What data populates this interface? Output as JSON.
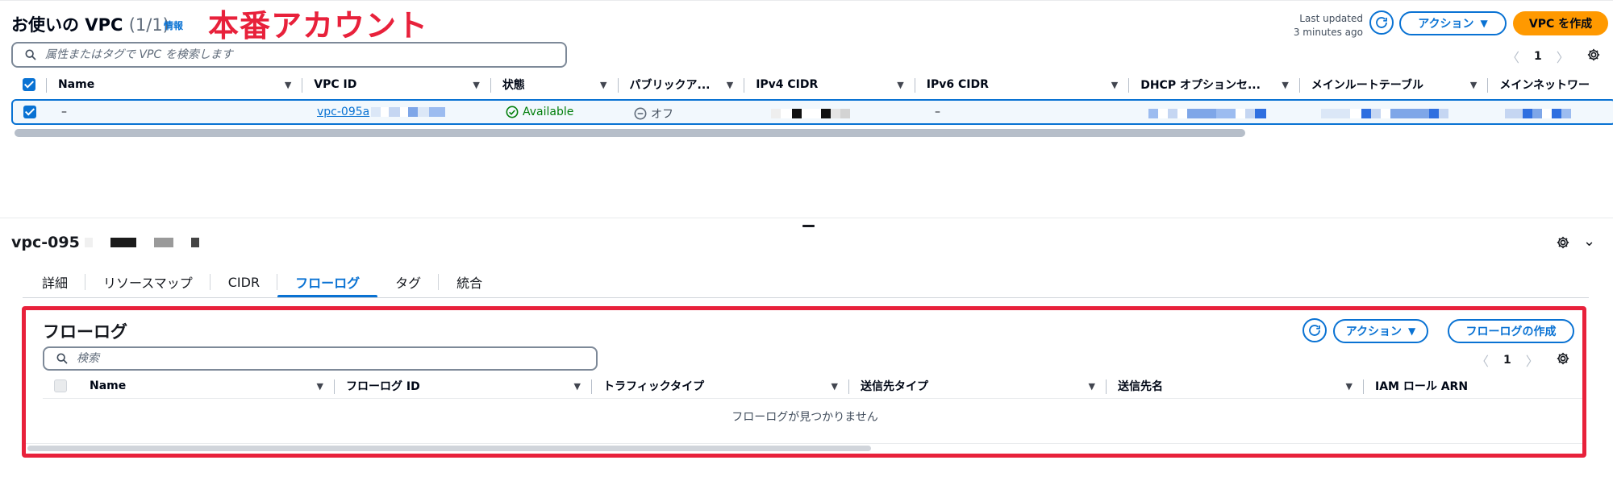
{
  "header": {
    "title": "お使いの VPC",
    "count": "(1/1)",
    "info": "情報",
    "prod_label": "本番アカウント",
    "last_updated_line1": "Last updated",
    "last_updated_line2": "3 minutes ago",
    "actions_label": "アクション",
    "create_vpc_label": "VPC を作成"
  },
  "search": {
    "placeholder": "属性またはタグで VPC を検索します"
  },
  "pagination": {
    "page": "1"
  },
  "table": {
    "columns": [
      "Name",
      "VPC ID",
      "状態",
      "パブリックア...",
      "IPv4 CIDR",
      "IPv6 CIDR",
      "DHCP オプションセ...",
      "メインルートテーブル",
      "メインネットワー"
    ],
    "row": {
      "name": "–",
      "vpc_id": "vpc-095a",
      "state": "Available",
      "public": "オフ",
      "ipv6": "–"
    }
  },
  "detail": {
    "vpc_id": "vpc-095",
    "tabs": [
      "詳細",
      "リソースマップ",
      "CIDR",
      "フローログ",
      "タグ",
      "統合"
    ],
    "active_tab": "フローログ"
  },
  "flow_logs": {
    "title": "フローログ",
    "actions_label": "アクション",
    "create_label": "フローログの作成",
    "search_placeholder": "検索",
    "page": "1",
    "columns": [
      "Name",
      "フローログ ID",
      "トラフィックタイプ",
      "送信先タイプ",
      "送信先名",
      "IAM ロール ARN"
    ],
    "empty_message": "フローログが見つかりません"
  },
  "colors": {
    "accent": "#0972d3",
    "primary": "#ff9900",
    "highlight": "#e8213b",
    "success": "#037f0c"
  }
}
